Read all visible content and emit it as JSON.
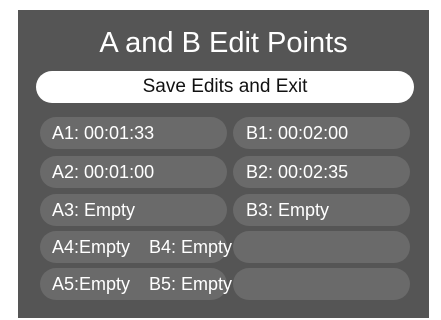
{
  "title": "A and B Edit Points",
  "save_button_label": "Save Edits and Exit",
  "points": {
    "a1": "A1: 00:01:33",
    "b1": "B1: 00:02:00",
    "a2": "A2: 00:01:00",
    "b2": "B2: 00:02:35",
    "a3": "A3: Empty",
    "b3": "B3: Empty",
    "a4": "A4:Empty",
    "b4": "B4: Empty",
    "a5": "A5:Empty",
    "b5": "B5: Empty"
  }
}
